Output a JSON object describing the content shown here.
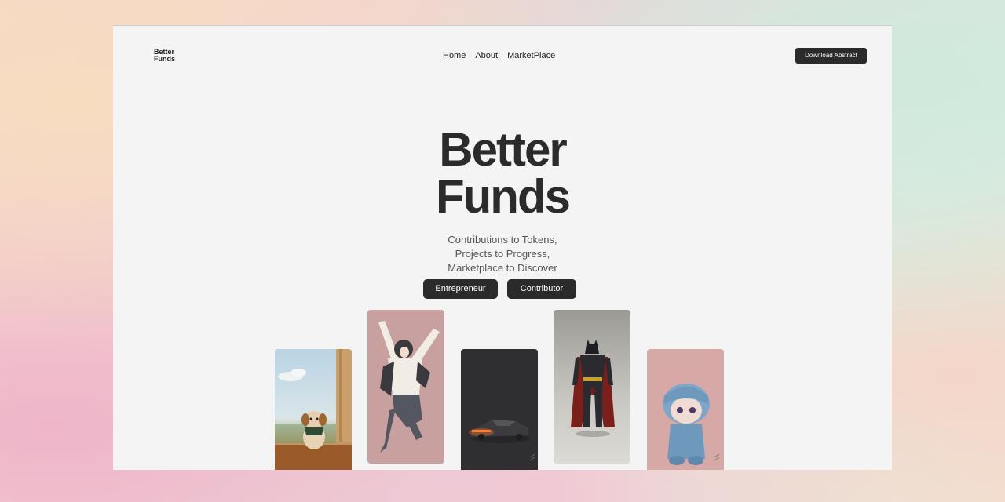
{
  "brand": {
    "line1": "Better",
    "line2": "Funds"
  },
  "nav": {
    "items": [
      "Home",
      "About",
      "MarketPlace"
    ]
  },
  "header": {
    "download_label": "Download Abstract"
  },
  "hero": {
    "title_line1": "Better",
    "title_line2": "Funds",
    "subtitle_lines": [
      "Contributions to Tokens,",
      "Projects to Progress,",
      "Marketplace to Discover"
    ]
  },
  "cta": {
    "entrepreneur_label": "Entrepreneur",
    "contributor_label": "Contributor"
  },
  "gallery": [
    "puppy-image",
    "jumping-person-image",
    "cybertruck-image",
    "batman-figure-image",
    "plush-doll-image"
  ],
  "colors": {
    "dark": "#2b2b2b",
    "page_bg": "#f4f4f4"
  }
}
